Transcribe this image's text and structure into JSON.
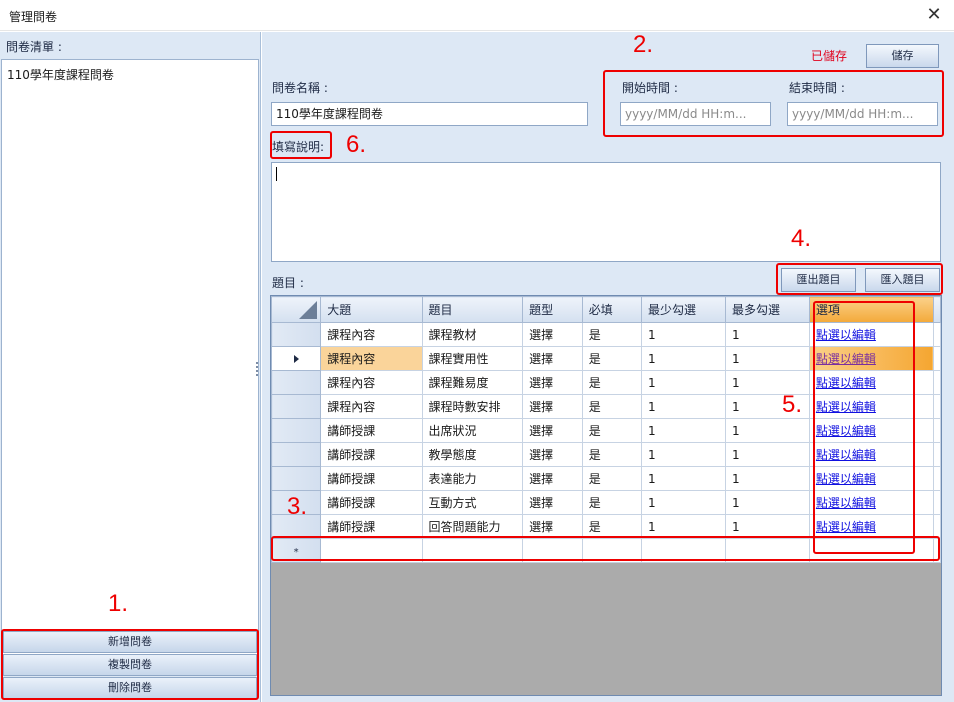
{
  "window": {
    "title": "管理問卷",
    "close_icon": "✕"
  },
  "left": {
    "header": "問卷清單 :",
    "items": [
      "110學年度課程問卷"
    ],
    "buttons": {
      "add": "新增問卷",
      "copy": "複製問卷",
      "delete": "刪除問卷"
    }
  },
  "right": {
    "saved_status": "已儲存",
    "save_button": "儲存",
    "name_label": "問卷名稱 :",
    "name_value": "110學年度課程問卷",
    "start_label": "開始時間 :",
    "start_placeholder": "yyyy/MM/dd HH:m...",
    "end_label": "結束時間 :",
    "end_placeholder": "yyyy/MM/dd HH:m...",
    "desc_label": "填寫說明:",
    "desc_value": "",
    "questions_label": "題目 :",
    "export_button": "匯出題目",
    "import_button": "匯入題目"
  },
  "grid": {
    "columns": [
      "大題",
      "題目",
      "題型",
      "必填",
      "最少勾選",
      "最多勾選",
      "選項"
    ],
    "rows": [
      [
        "課程內容",
        "課程教材",
        "選擇",
        "是",
        "1",
        "1",
        "點選以編輯"
      ],
      [
        "課程內容",
        "課程實用性",
        "選擇",
        "是",
        "1",
        "1",
        "點選以編輯"
      ],
      [
        "課程內容",
        "課程難易度",
        "選擇",
        "是",
        "1",
        "1",
        "點選以編輯"
      ],
      [
        "課程內容",
        "課程時數安排",
        "選擇",
        "是",
        "1",
        "1",
        "點選以編輯"
      ],
      [
        "講師授課",
        "出席狀況",
        "選擇",
        "是",
        "1",
        "1",
        "點選以編輯"
      ],
      [
        "講師授課",
        "教學態度",
        "選擇",
        "是",
        "1",
        "1",
        "點選以編輯"
      ],
      [
        "講師授課",
        "表達能力",
        "選擇",
        "是",
        "1",
        "1",
        "點選以編輯"
      ],
      [
        "講師授課",
        "互動方式",
        "選擇",
        "是",
        "1",
        "1",
        "點選以編輯"
      ],
      [
        "講師授課",
        "回答問題能力",
        "選擇",
        "是",
        "1",
        "1",
        "點選以編輯"
      ]
    ],
    "selected_row_index": 1,
    "new_row_marker": "*"
  },
  "annotations": [
    "1.",
    "2.",
    "3.",
    "4.",
    "5.",
    "6."
  ],
  "colors": {
    "annotation": "#ee0000",
    "saved": "#e0001b",
    "selection": "#f5a631",
    "link": "#1010e0"
  }
}
